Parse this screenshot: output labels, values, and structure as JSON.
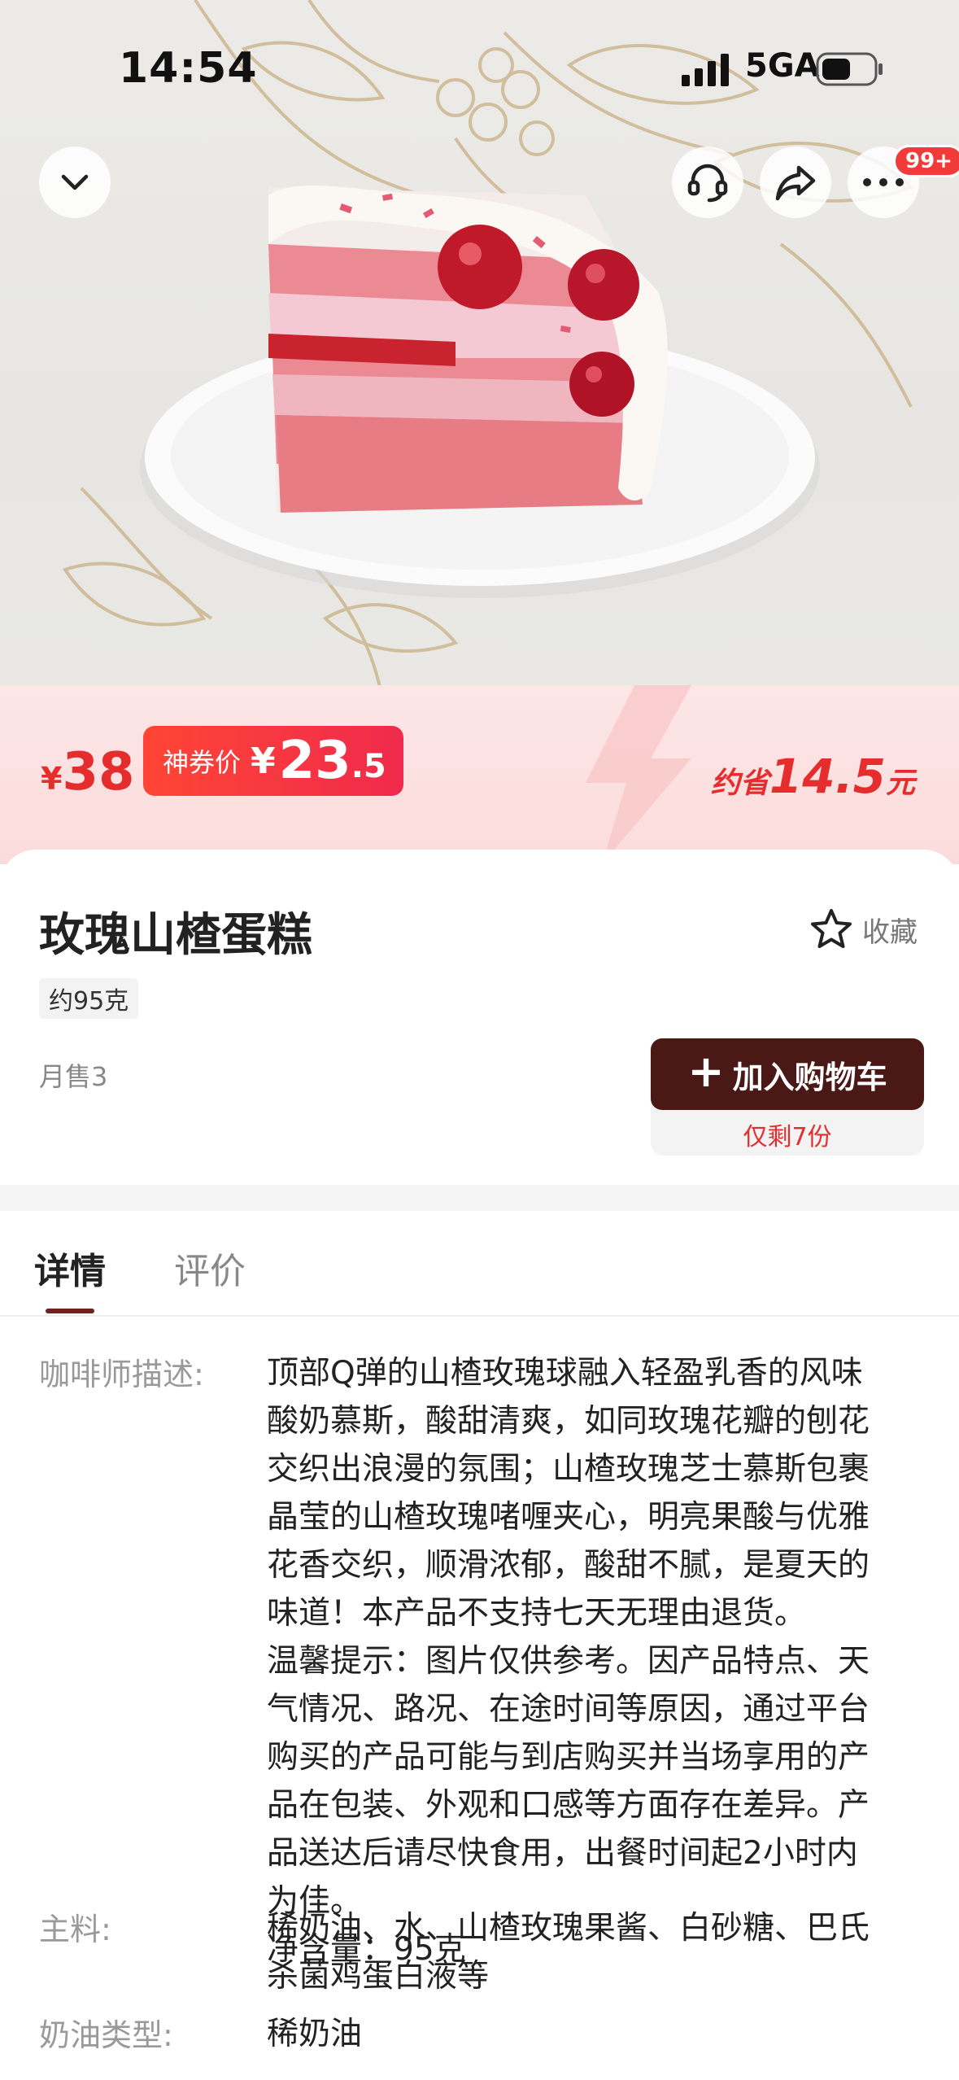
{
  "status_bar": {
    "time": "14:54",
    "network": "5GA"
  },
  "top_actions": {
    "more_badge": "99+"
  },
  "price": {
    "original_currency": "¥",
    "original_value": "38",
    "coupon_label": "神券价",
    "coupon_currency": "¥",
    "coupon_integer": "23",
    "coupon_decimal": ".5",
    "saving_prefix": "约省",
    "saving_amount": "14.5",
    "saving_unit": "元"
  },
  "product": {
    "name": "玫瑰山楂蛋糕",
    "favorite_label": "收藏",
    "weight": "约95克",
    "monthly_sales": "月售3",
    "add_to_cart_label": "加入购物车",
    "remaining": "仅剩7份"
  },
  "tabs": {
    "detail": "详情",
    "review": "评价"
  },
  "details": {
    "description_label": "咖啡师描述:",
    "description_value": "顶部Q弹的山楂玫瑰球融入轻盈乳香的风味\n酸奶慕斯，酸甜清爽，如同玫瑰花瓣的刨花\n交织出浪漫的氛围；山楂玫瑰芝士慕斯包裹\n晶莹的山楂玫瑰啫喱夹心，明亮果酸与优雅\n花香交织，顺滑浓郁，酸甜不腻，是夏天的\n味道！本产品不支持七天无理由退货。\n温馨提示：图片仅供参考。因产品特点、天\n气情况、路况、在途时间等原因，通过平台\n购买的产品可能与到店购买并当场享用的产\n品在包装、外观和口感等方面存在差异。产\n品送达后请尽快食用，出餐时间起2小时内\n为佳。\n净含量：95克",
    "main_label": "主料:",
    "main_value": "稀奶油、水、山楂玫瑰果酱、白砂糖、巴氏\n杀菌鸡蛋白液等",
    "cream_label": "奶油类型:",
    "cream_value": "稀奶油"
  },
  "icons": {
    "back": "chevron-down-icon",
    "service": "headset-icon",
    "share": "share-icon",
    "more": "more-icon",
    "favorite": "star-icon"
  },
  "colors": {
    "accent_red": "#e62d2d",
    "cart_brown": "#4a1815",
    "banner_pink": "#fde6e6"
  }
}
